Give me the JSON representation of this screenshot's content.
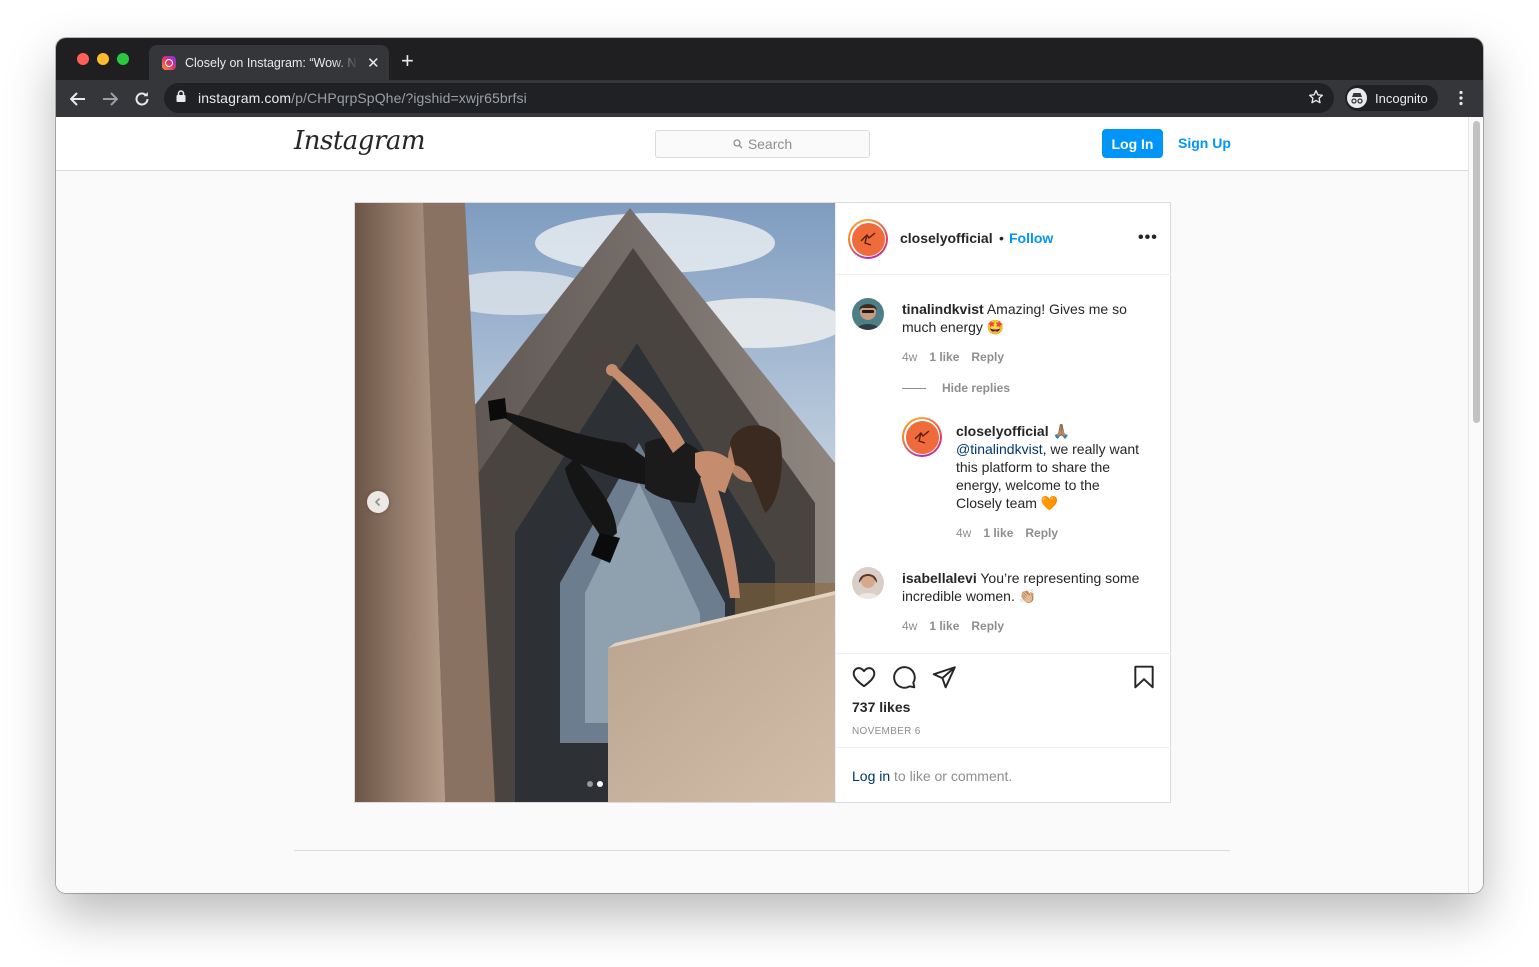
{
  "browser": {
    "tab_title": "Closely on Instagram: “Wow. N",
    "url_domain": "instagram.com",
    "url_path": "/p/CHPqrpSpQhe/?igshid=xwjr65brfsi",
    "profile_label": "Incognito",
    "icons": [
      "back-icon",
      "forward-icon",
      "reload-icon",
      "lock-icon",
      "star-icon",
      "incognito-icon",
      "kebab-menu-icon"
    ]
  },
  "header": {
    "logo": "Instagram",
    "search_placeholder": "Search",
    "login_label": "Log In",
    "signup_label": "Sign Up"
  },
  "post": {
    "username": "closelyofficial",
    "follow_label": "Follow",
    "separator": "•",
    "more_label": "•••",
    "image_count": 2,
    "active_image": 2,
    "comments": [
      {
        "user": "tinalindkvist",
        "text": "Amazing! Gives me so much energy 🤩",
        "age": "4w",
        "likes": "1 like",
        "reply": "Reply"
      },
      {
        "user": "isabellalevi",
        "text": "You’re representing some incredible women. 👏🏼",
        "age": "4w",
        "likes": "1 like",
        "reply": "Reply"
      }
    ],
    "hide_replies_label": "Hide replies",
    "reply": {
      "user": "closelyofficial",
      "emoji": "🙏🏽",
      "mention": "@tinalindkvist",
      "text": ", we really want this platform to share the energy, welcome to the Closely team 🧡",
      "age": "4w",
      "likes": "1 like",
      "reply": "Reply"
    },
    "likes": "737 likes",
    "date": "NOVEMBER 6",
    "login_link": "Log in",
    "login_suffix": " to like or comment."
  },
  "colors": {
    "accent": "#0095f6",
    "link": "#00376b",
    "text": "#262626",
    "muted": "#8e8e8e",
    "brand": "#ef6b3c"
  }
}
